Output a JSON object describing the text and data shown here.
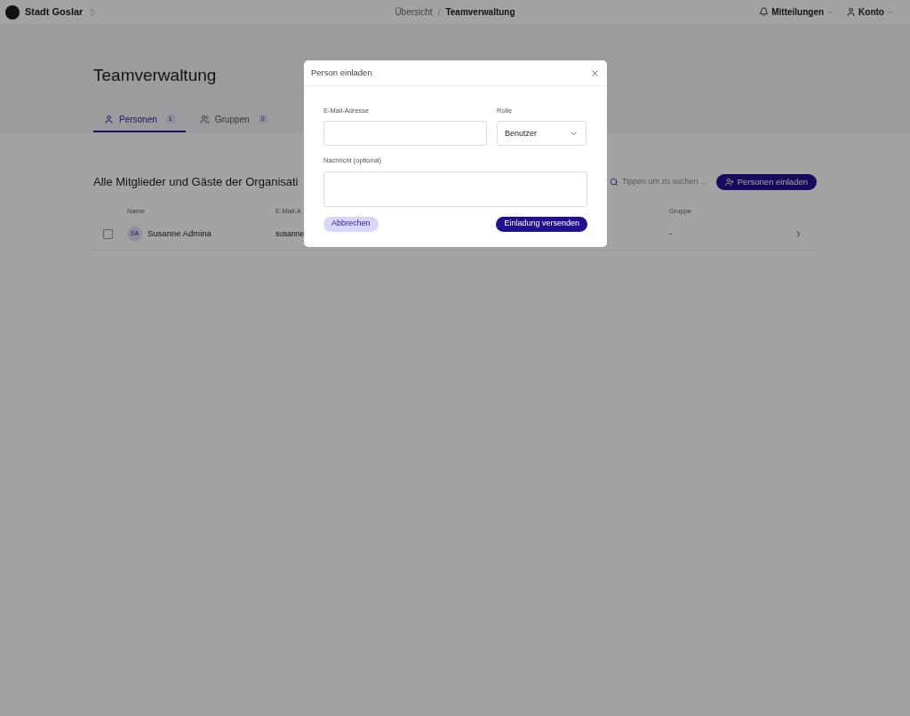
{
  "org": {
    "name": "Stadt Goslar"
  },
  "breadcrumb_separator": "/",
  "breadcrumb": [
    {
      "label": "Übersicht",
      "current": false
    },
    {
      "label": "Teamverwaltung",
      "current": true
    }
  ],
  "top_actions": [
    {
      "label": "Mitteilungen",
      "kind": "bell"
    },
    {
      "label": "Konto",
      "kind": "user"
    }
  ],
  "page_title": "Teamverwaltung",
  "tabs": [
    {
      "label": "Personen",
      "count": "1",
      "selected": true,
      "kind": "user"
    },
    {
      "label": "Gruppen",
      "count": "0",
      "selected": false,
      "kind": "users"
    }
  ],
  "section_title": "Alle Mitglieder und Gäste der Organisati",
  "search": {
    "placeholder": "Tippen um zu suchen ..."
  },
  "invite_button": "Personen einladen",
  "table": {
    "columns": [
      "Name",
      "E-Mail-A",
      "Gruppe"
    ],
    "rows": [
      {
        "checked": false,
        "initials": "SA",
        "name": "Susanne Admina",
        "email": "susanne",
        "group": "-"
      }
    ]
  },
  "dialog": {
    "title": "Person einladen",
    "email_label": "E-Mail-Adresse",
    "role_label": "Rolle",
    "role_value": "Benutzer",
    "message_label": "Nachricht (optional)",
    "cancel": "Abbrechen",
    "submit": "Einladung versenden"
  }
}
